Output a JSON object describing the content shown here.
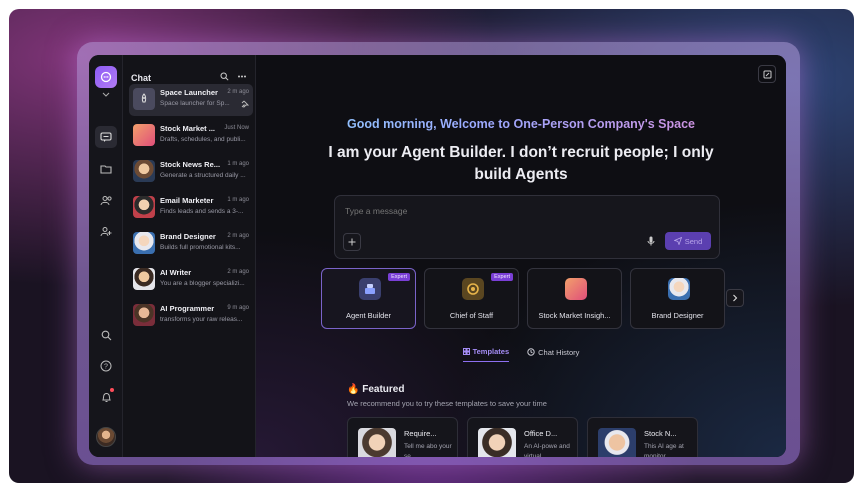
{
  "sidebar": {
    "chat_title": "Chat"
  },
  "chats": [
    {
      "name": "Space Launcher",
      "time": "2 m ago",
      "preview": "Space launcher for Sp..."
    },
    {
      "name": "Stock Market ...",
      "time": "Just Now",
      "preview": "Drafts, schedules, and publi..."
    },
    {
      "name": "Stock News Re...",
      "time": "1 m ago",
      "preview": "Generate a structured daily ..."
    },
    {
      "name": "Email Marketer",
      "time": "1 m ago",
      "preview": "Finds leads and sends a 3-..."
    },
    {
      "name": "Brand Designer",
      "time": "2 m ago",
      "preview": "Builds full promotional kits..."
    },
    {
      "name": "AI Writer",
      "time": "2 m ago",
      "preview": "You are a blogger specializi..."
    },
    {
      "name": "AI Programmer",
      "time": "9 m ago",
      "preview": "transforms your raw releas..."
    }
  ],
  "main": {
    "greeting": "Good morning, Welcome to One-Person Company's Space",
    "headline": "I am your Agent Builder. I don’t recruit people; I only build Agents",
    "composer": {
      "placeholder": "Type a message",
      "send_label": "Send"
    },
    "agents": [
      {
        "label": "Agent Builder",
        "badge": "Expert"
      },
      {
        "label": "Chief of Staff",
        "badge": "Expert"
      },
      {
        "label": "Stock Market Insigh...",
        "badge": ""
      },
      {
        "label": "Brand Designer",
        "badge": ""
      }
    ],
    "tabs": {
      "templates": "Templates",
      "history": "Chat History"
    },
    "featured": {
      "title": "Featured",
      "subtitle": "We recommend you to try these templates to save your time"
    },
    "templates": [
      {
        "name": "Require...",
        "desc": "Tell me abo your se..."
      },
      {
        "name": "Office D...",
        "desc": "An AI-powe and virtual..."
      },
      {
        "name": "Stock N...",
        "desc": "This AI age at monitor..."
      }
    ]
  },
  "colors": {
    "accent": "#8d6ff0",
    "badge": "#7a3fd6",
    "notification": "#ff4d5a"
  }
}
